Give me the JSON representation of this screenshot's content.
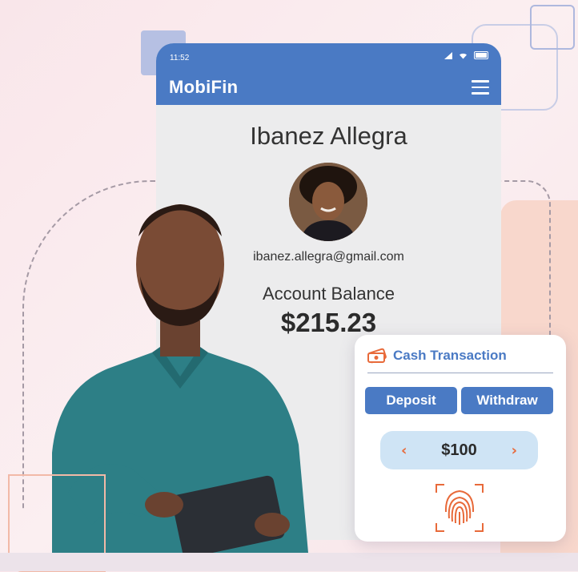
{
  "status_bar": {
    "time": "11:52"
  },
  "app": {
    "brand": "MobiFin",
    "menu_icon": "hamburger-menu-icon"
  },
  "profile": {
    "name": "Ibanez Allegra",
    "email": "ibanez.allegra@gmail.com",
    "balance_label": "Account Balance",
    "balance_value": "$215.23"
  },
  "transaction": {
    "title": "Cash Transaction",
    "icon": "cash-icon",
    "deposit_label": "Deposit",
    "withdraw_label": "Withdraw",
    "amount": "$100",
    "prev_icon": "chevron-left-icon",
    "next_icon": "chevron-right-icon",
    "fingerprint_icon": "fingerprint-icon"
  },
  "colors": {
    "primary": "#4a7ac4",
    "accent": "#e86a3a",
    "stepper_bg": "#cfe4f5",
    "background": "#f9e6ea"
  }
}
